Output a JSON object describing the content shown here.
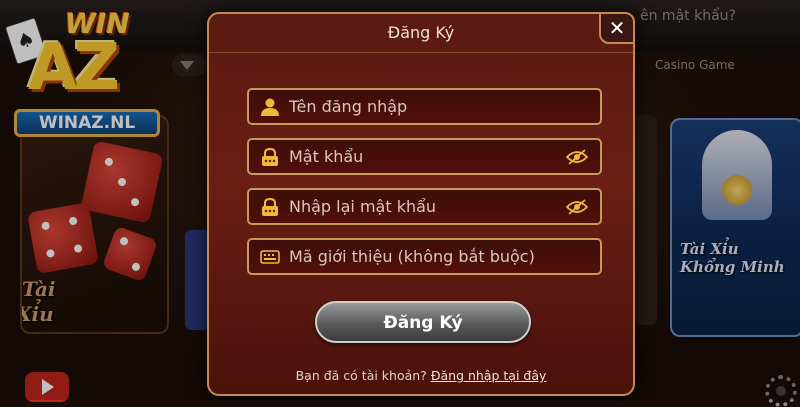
{
  "background": {
    "topbar_text": "ên mật khẩu?",
    "casino_tab": "Casino Game",
    "left_card_title": [
      "Tài",
      "Xỉu"
    ],
    "right_card_title": "Tài Xỉu Khổng Minh",
    "logo_win": "WIN",
    "logo_az": "AZ",
    "logo_domain": "WINAZ.NL"
  },
  "dialog": {
    "title": "Đăng Ký",
    "close_icon": "close-icon",
    "fields": {
      "username": {
        "placeholder": "Tên đăng nhập",
        "icon": "user-icon"
      },
      "password": {
        "placeholder": "Mật khẩu",
        "icon": "lock-icon",
        "toggle_icon": "eye-slash-icon"
      },
      "confirm_password": {
        "placeholder": "Nhập lại mật khẩu",
        "icon": "lock-icon",
        "toggle_icon": "eye-slash-icon"
      },
      "referral": {
        "placeholder": "Mã giới thiệu (không bắt buộc)",
        "icon": "keyboard-icon"
      }
    },
    "submit_label": "Đăng Ký",
    "footer_text": "Bạn đã có tài khoản?",
    "footer_link": "Đăng nhập tại đây"
  },
  "colors": {
    "dialog_bg": "#5a1a12",
    "field_border": "#c79a58",
    "icon_gold": "#f0b93a"
  }
}
